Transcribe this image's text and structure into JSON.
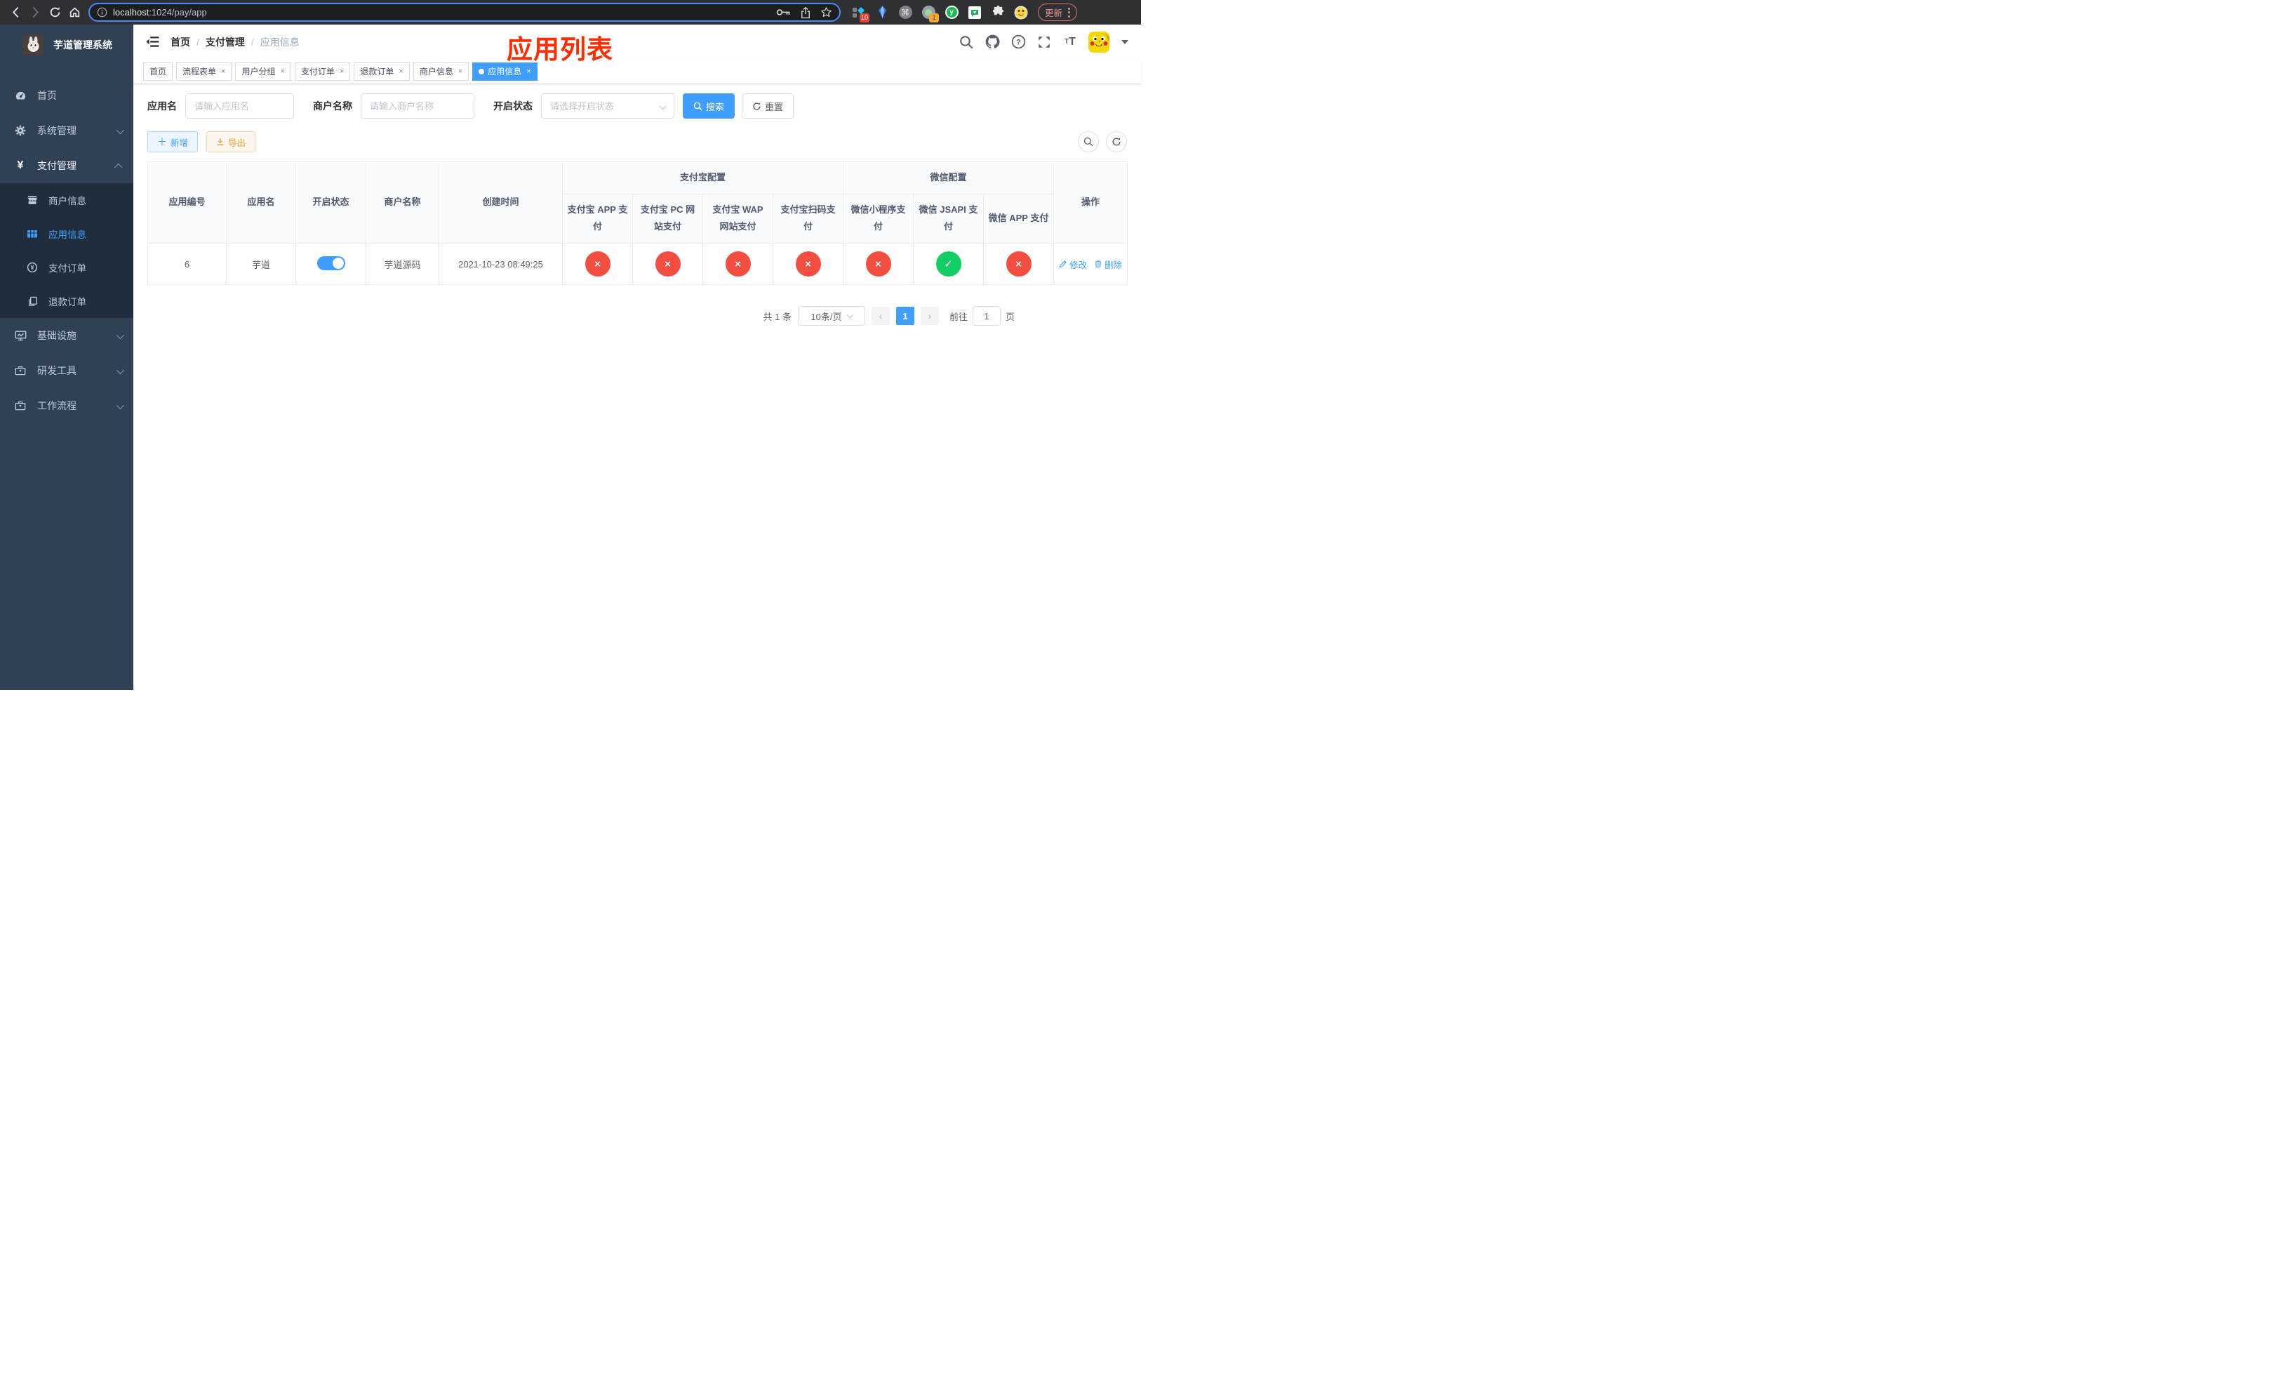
{
  "colors": {
    "accent": "#409eff",
    "success": "#13ce66",
    "danger": "#f24e42",
    "warning": "#e6a23c",
    "sidebar_bg": "#304156",
    "submenu_bg": "#1f2d3d",
    "annotation_red": "#ff2e00",
    "update_pill": "#e2726a"
  },
  "browser": {
    "url_host": "localhost",
    "url_rest": ":1024/pay/app",
    "extension_badge_count": "10",
    "extension_badge_count_2": "1",
    "update_label": "更新",
    "icons": [
      "back-arrow",
      "forward-arrow",
      "reload",
      "home",
      "info-circle",
      "key",
      "share",
      "star",
      "extensions-puzzle"
    ]
  },
  "sidebar": {
    "title": "芋道管理系统",
    "items": [
      {
        "label": "首页",
        "icon": "dashboard-icon"
      },
      {
        "label": "系统管理",
        "icon": "gear-icon",
        "arrow": "down"
      },
      {
        "label": "支付管理",
        "icon": "yen-icon",
        "arrow": "up"
      },
      {
        "label": "商户信息",
        "icon": "shop-icon"
      },
      {
        "label": "应用信息",
        "icon": "grid-icon",
        "active": true
      },
      {
        "label": "支付订单",
        "icon": "yen-circle-icon"
      },
      {
        "label": "退款订单",
        "icon": "documents-icon"
      },
      {
        "label": "基础设施",
        "icon": "monitor-icon",
        "arrow": "down"
      },
      {
        "label": "研发工具",
        "icon": "briefcase-icon",
        "arrow": "down"
      },
      {
        "label": "工作流程",
        "icon": "briefcase-icon",
        "arrow": "down"
      }
    ]
  },
  "navbar": {
    "breadcrumb": [
      "首页",
      "支付管理",
      "应用信息"
    ],
    "annotation": "应用列表",
    "right_icons": [
      "search-icon",
      "github-icon",
      "help-icon",
      "fullscreen-icon",
      "font-size-icon",
      "avatar",
      "caret-down-icon"
    ]
  },
  "tabs": [
    {
      "label": "首页",
      "closable": false,
      "active": false
    },
    {
      "label": "流程表单",
      "closable": true,
      "active": false
    },
    {
      "label": "用户分组",
      "closable": true,
      "active": false
    },
    {
      "label": "支付订单",
      "closable": true,
      "active": false
    },
    {
      "label": "退款订单",
      "closable": true,
      "active": false
    },
    {
      "label": "商户信息",
      "closable": true,
      "active": false
    },
    {
      "label": "应用信息",
      "closable": true,
      "active": true
    }
  ],
  "filters": {
    "app_name_label": "应用名",
    "app_name_placeholder": "请输入应用名",
    "merchant_label": "商户名称",
    "merchant_placeholder": "请输入商户名称",
    "status_label": "开启状态",
    "status_placeholder": "请选择开启状态",
    "search_label": "搜索",
    "reset_label": "重置"
  },
  "toolbar": {
    "add_label": "新增",
    "export_label": "导出"
  },
  "table": {
    "col_app_id": "应用编号",
    "col_app_name": "应用名",
    "col_status": "开启状态",
    "col_merchant": "商户名称",
    "col_created": "创建时间",
    "group_alipay": "支付宝配置",
    "group_wechat": "微信配置",
    "col_op": "操作",
    "alipay_cols": [
      "支付宝 APP 支付",
      "支付宝 PC 网站支付",
      "支付宝 WAP 网站支付",
      "支付宝扫码支付"
    ],
    "wechat_cols": [
      "微信小程序支付",
      "微信 JSAPI 支付",
      "微信 APP 支付"
    ],
    "row": {
      "app_id": "6",
      "app_name": "芋道",
      "enabled": true,
      "merchant": "芋道源码",
      "created": "2021-10-23 08:49:25",
      "statuses": [
        "no",
        "no",
        "no",
        "no",
        "no",
        "yes",
        "no"
      ],
      "edit_label": "修改",
      "delete_label": "删除"
    }
  },
  "pagination": {
    "total": "共 1 条",
    "page_size": "10条/页",
    "current_page": "1",
    "goto_label": "前往",
    "goto_value": "1",
    "goto_suffix": "页"
  }
}
